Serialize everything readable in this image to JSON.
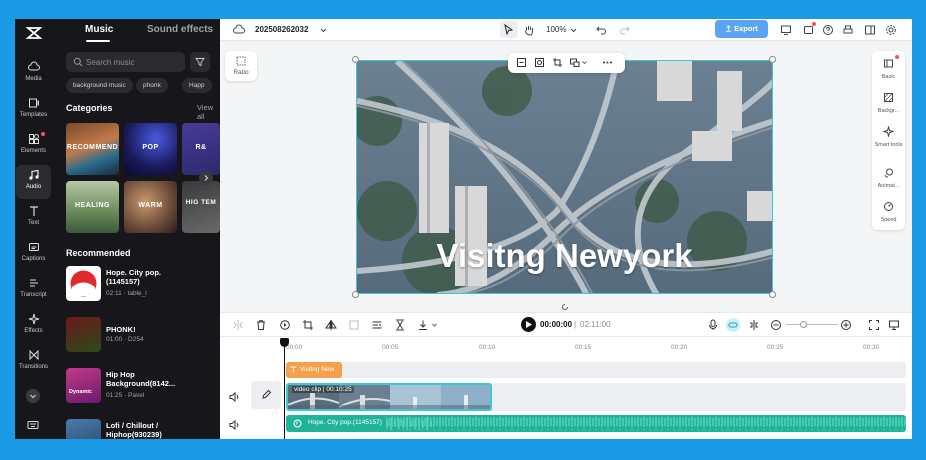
{
  "nav": {
    "items": [
      {
        "label": "Media"
      },
      {
        "label": "Templates"
      },
      {
        "label": "Elements"
      },
      {
        "label": "Audio"
      },
      {
        "label": "Text"
      },
      {
        "label": "Captions"
      },
      {
        "label": "Transcript"
      },
      {
        "label": "Effects"
      },
      {
        "label": "Transitions"
      }
    ],
    "active": "Audio"
  },
  "panel": {
    "tabs": {
      "music": "Music",
      "sound": "Sound effects"
    },
    "search_placeholder": "Search music",
    "chips": [
      "background music",
      "phonk",
      "Happ"
    ],
    "categories_title": "Categories",
    "view_all": "View all",
    "categories": [
      "RECOMMEND",
      "POP",
      "R&",
      "HEALING",
      "WARM",
      "HIG TEM"
    ],
    "recommended_title": "Recommended",
    "recommended": [
      {
        "title": "Hope. City pop. (1145157)",
        "meta": "02:11 · table_l"
      },
      {
        "title": "PHONK!",
        "meta": "01:00 · D254"
      },
      {
        "title": "Hip Hop Background(8142...",
        "meta": "01:25 · Pavel",
        "thumb_text": "Dynamic"
      },
      {
        "title": "Lofi / Chillout / Hiphop(930239)",
        "meta": ""
      }
    ]
  },
  "topbar": {
    "project_name": "2025082620​32",
    "zoom": "100%",
    "export_label": "Export"
  },
  "canvas": {
    "ratio_label": "Ratio",
    "title_text": "Visitng Newyork"
  },
  "right_rail": [
    "Basic",
    "Backgr...",
    "Smart tools",
    "Animat...",
    "Speed"
  ],
  "timeline": {
    "current_time": "00:00:00",
    "total_time": "02:11:00",
    "ruler": [
      "00:00",
      "00:05",
      "00:10",
      "00:15",
      "00:20",
      "00:25",
      "00:30"
    ],
    "text_clip": "Visitng New",
    "video_clip": "video clip | 00:10:25",
    "audio_clip": "Hope. City pop.(1145157)"
  },
  "colors": {
    "accent": "#3cc9d6",
    "export": "#5aa4f3",
    "text_clip": "#f5a04a",
    "audio_clip": "#1fb39a",
    "sidebar": "#17171b"
  }
}
